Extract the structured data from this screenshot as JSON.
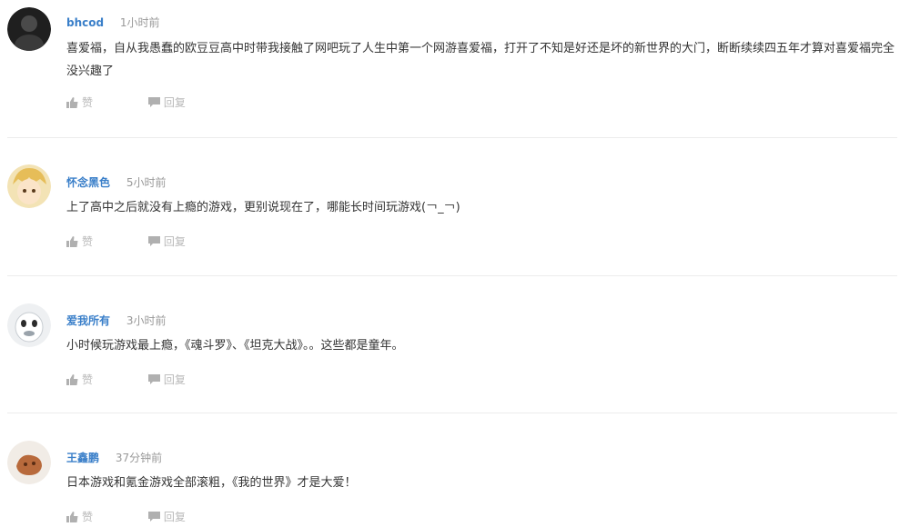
{
  "comments": [
    {
      "username": "bhcod",
      "time": "1小时前",
      "text": "喜爱福，自从我愚蠢的欧豆豆高中时带我接触了网吧玩了人生中第一个网游喜爱福，打开了不知是好还是坏的新世界的大门，断断续续四五年才算对喜爱福完全没兴趣了",
      "like_label": "赞",
      "reply_label": "回复",
      "avatar_color": "#2a2a2a"
    },
    {
      "username": "怀念黑色",
      "time": "5小时前",
      "text": "上了高中之后就没有上瘾的游戏，更别说现在了，哪能长时间玩游戏(￢_￢)",
      "like_label": "赞",
      "reply_label": "回复",
      "avatar_color": "#e9c777"
    },
    {
      "username": "爱我所有",
      "time": "3小时前",
      "text": "小时候玩游戏最上瘾，《魂斗罗》、《坦克大战》。。这些都是童年。",
      "like_label": "赞",
      "reply_label": "回复",
      "avatar_color": "#d9dde0"
    },
    {
      "username": "王鑫鹏",
      "time": "37分钟前",
      "text": "日本游戏和氪金游戏全部滚粗，《我的世界》才是大爱！",
      "like_label": "赞",
      "reply_label": "回复",
      "avatar_color": "#b86a3c"
    }
  ],
  "colors": {
    "username": "#3a7fc9",
    "muted": "#999999",
    "action": "#b8b8b8",
    "divider": "#ececec"
  },
  "icons": {
    "like": "thumbs-up-icon",
    "reply": "speech-bubble-icon"
  }
}
